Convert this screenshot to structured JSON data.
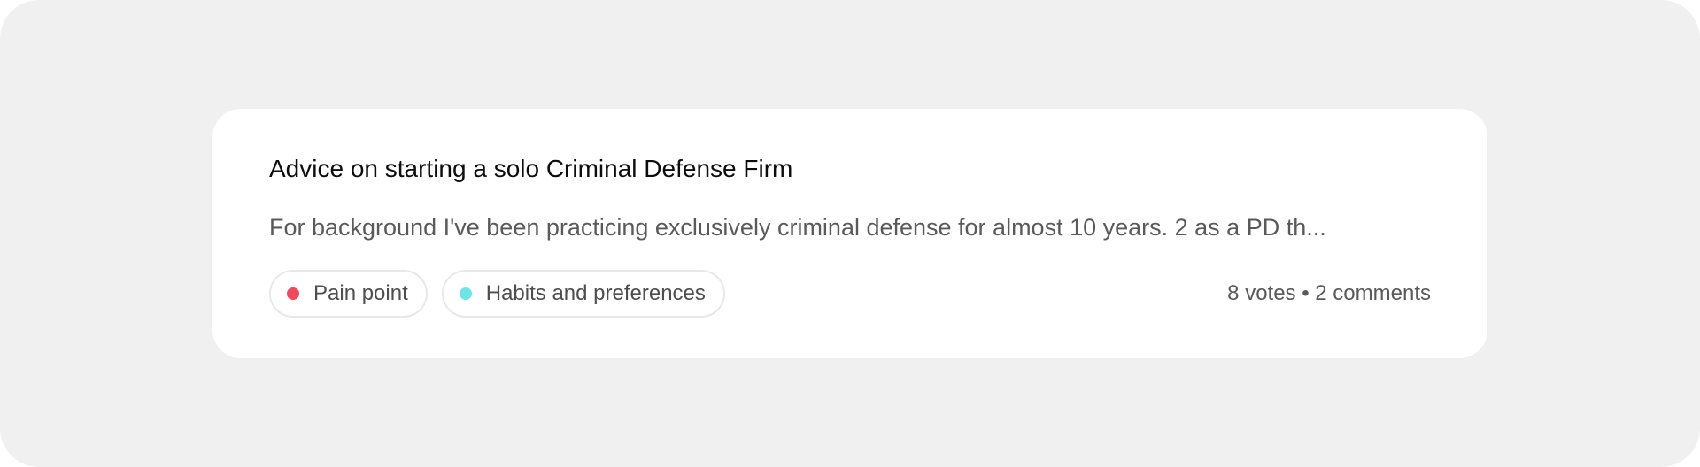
{
  "post": {
    "title": "Advice on starting a solo Criminal Defense Firm",
    "excerpt": "For background I've been practicing exclusively criminal defense for almost 10 years. 2 as a PD th...",
    "tags": [
      {
        "label": "Pain point",
        "color": "#f0475c"
      },
      {
        "label": "Habits and preferences",
        "color": "#6ee5e4"
      }
    ],
    "stats": "8 votes • 2 comments"
  },
  "colors": {
    "background": "#eff0ef",
    "card": "#ffffff",
    "title_text": "#0d0d0d",
    "body_text": "#5a5a5a",
    "tag_border": "#e7e8e8"
  }
}
